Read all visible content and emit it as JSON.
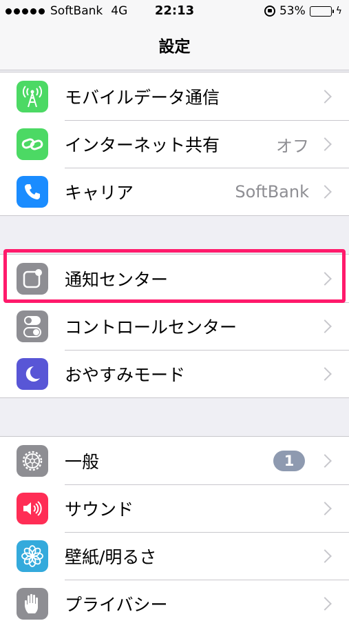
{
  "status_bar": {
    "carrier": "SoftBank",
    "network": "4G",
    "time": "22:13",
    "battery_percent": "53%",
    "battery_level": 0.53,
    "accent_color": "#4cd964"
  },
  "nav": {
    "title": "設定"
  },
  "groups": [
    {
      "rows": [
        {
          "label": "モバイルデータ通信",
          "value": "",
          "icon": "cellular-antenna-icon",
          "icon_color": "#4cd964"
        },
        {
          "label": "インターネット共有",
          "value": "オフ",
          "icon": "hotspot-link-icon",
          "icon_color": "#4cd964"
        },
        {
          "label": "キャリア",
          "value": "SoftBank",
          "icon": "phone-icon",
          "icon_color": "#1a8cff"
        }
      ]
    },
    {
      "rows": [
        {
          "label": "通知センター",
          "value": "",
          "icon": "notification-center-icon",
          "icon_color": "#8e8e93",
          "highlighted": true
        },
        {
          "label": "コントロールセンター",
          "value": "",
          "icon": "toggles-icon",
          "icon_color": "#8e8e93"
        },
        {
          "label": "おやすみモード",
          "value": "",
          "icon": "moon-icon",
          "icon_color": "#5856d6"
        }
      ]
    },
    {
      "rows": [
        {
          "label": "一般",
          "badge": "1",
          "icon": "gear-icon",
          "icon_color": "#8e8e93"
        },
        {
          "label": "サウンド",
          "value": "",
          "icon": "speaker-icon",
          "icon_color": "#ff2d55"
        },
        {
          "label": "壁紙/明るさ",
          "value": "",
          "icon": "flower-icon",
          "icon_color": "#34aadc"
        },
        {
          "label": "プライバシー",
          "value": "",
          "icon": "hand-icon",
          "icon_color": "#8e8e93"
        }
      ]
    }
  ],
  "highlight_color": "#ff1a6b"
}
